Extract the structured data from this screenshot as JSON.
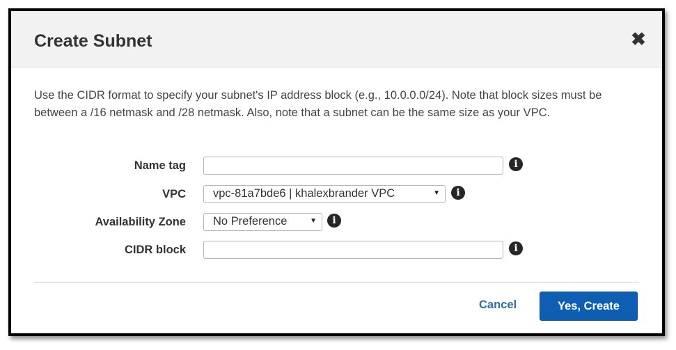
{
  "dialog": {
    "title": "Create Subnet",
    "close_glyph": "✖",
    "description": "Use the CIDR format to specify your subnet's IP address block (e.g., 10.0.0.0/24). Note that block sizes must be between a /16 netmask and /28 netmask. Also, note that a subnet can be the same size as your VPC."
  },
  "form": {
    "name_tag": {
      "label": "Name tag",
      "value": ""
    },
    "vpc": {
      "label": "VPC",
      "selected": "vpc-81a7bde6 | khalexbrander VPC"
    },
    "availability_zone": {
      "label": "Availability Zone",
      "selected": "No Preference"
    },
    "cidr_block": {
      "label": "CIDR block",
      "value": ""
    },
    "info_glyph": "i",
    "dropdown_glyph": "▼"
  },
  "footer": {
    "cancel_label": "Cancel",
    "create_label": "Yes, Create"
  },
  "colors": {
    "primary_button": "#0e5fb4",
    "link": "#2e6da4",
    "header_bg": "#f2f2f2"
  }
}
